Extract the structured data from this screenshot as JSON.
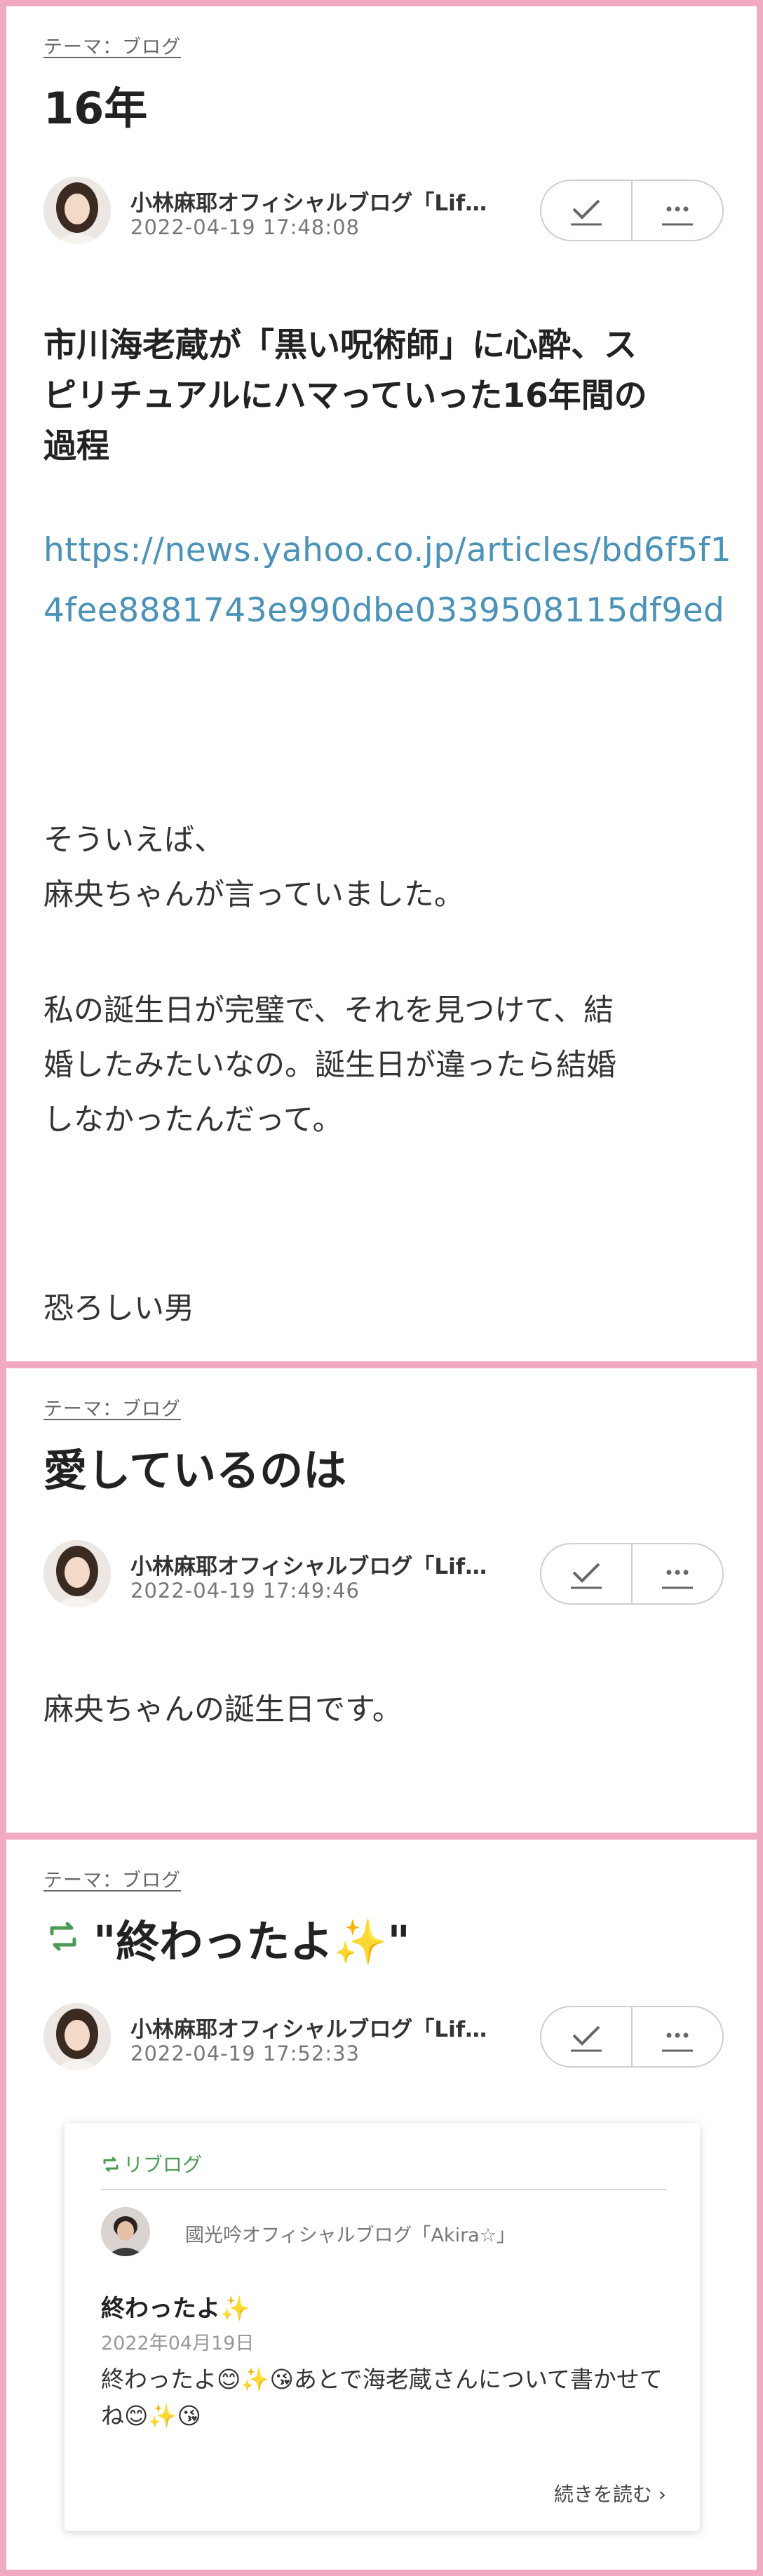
{
  "posts": [
    {
      "theme": "テーマ：ブログ",
      "title": "16年",
      "author": "小林麻耶オフィシャルブログ「Lif…",
      "date": "2022-04-19 17:48:08",
      "headline": [
        "市川海老蔵が「黒い呪術師」に心酔、ス",
        "ピリチュアルにハマっていった16年間の",
        "過程"
      ],
      "link": "https://news.yahoo.co.jp/articles/bd6f5f14fee8881743e990dbe0339508115df9ed",
      "paragraphs": [
        [
          "そういえば、",
          "麻央ちゃんが言っていました。"
        ],
        [
          "私の誕生日が完璧で、それを見つけて、結",
          "婚したみたいなの。誕生日が違ったら結婚",
          "しなかったんだって。"
        ],
        [
          "恐ろしい男"
        ]
      ]
    },
    {
      "theme": "テーマ：ブログ",
      "title": "愛しているのは",
      "author": "小林麻耶オフィシャルブログ「Lif…",
      "date": "2022-04-19 17:49:46",
      "body": "麻央ちゃんの誕生日です。"
    },
    {
      "theme": "テーマ：ブログ",
      "title": "\"終わったよ✨\"",
      "author": "小林麻耶オフィシャルブログ「Lif…",
      "date": "2022-04-19 17:52:33",
      "reblog": {
        "label": "リブログ",
        "author": "國光吟オフィシャルブログ「Akira☆」",
        "title": "終わったよ✨",
        "date": "2022年04月19日",
        "body": "終わったよ😊✨😘あとで海老蔵さんについて書かせてね😊✨😘",
        "read_more": "続きを読む ›"
      }
    }
  ],
  "icons": {
    "check": "check-icon",
    "more": "more-icon",
    "reblog": "reblog-icon"
  },
  "colors": {
    "background_border": "#f2aac4",
    "link": "#4a92b8",
    "reblog_green": "#4c9a55"
  }
}
